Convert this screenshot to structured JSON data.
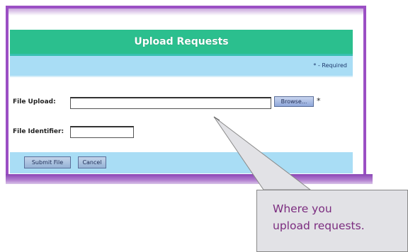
{
  "panel": {
    "title": "Upload Requests",
    "required_note": "* - Required"
  },
  "form": {
    "file_upload_label": "File Upload:",
    "browse_label": "Browse...",
    "required_marker": "*",
    "file_identifier_label": "File Identifier:",
    "file_upload_value": "",
    "file_identifier_value": ""
  },
  "footer": {
    "submit_label": "Submit File",
    "cancel_label": "Cancel"
  },
  "callout": {
    "line1": "Where you",
    "line2": "upload requests."
  },
  "colors": {
    "frame": "#9b4fc4",
    "header": "#2bbf8e",
    "subheader": "#a9ddf5",
    "callout_text": "#7b2c7f",
    "callout_bg": "#e2e2e6"
  },
  "icons": {
    "callout_pointer": "callout-pointer-icon"
  }
}
